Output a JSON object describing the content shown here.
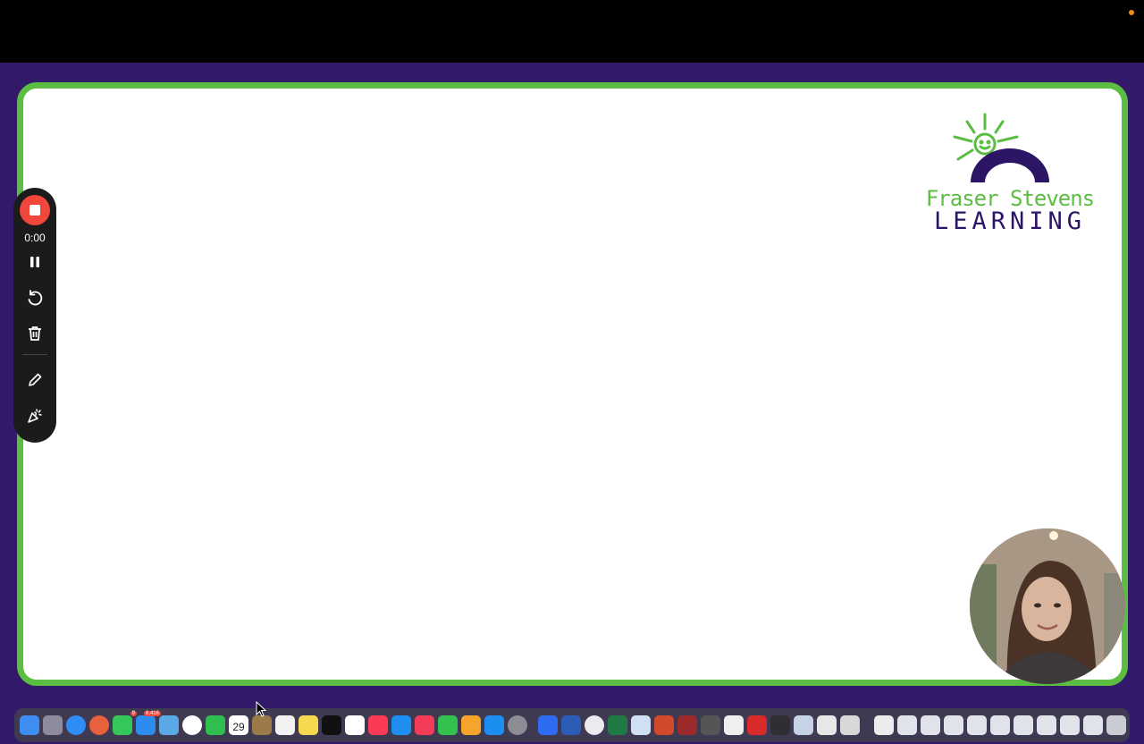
{
  "recorder": {
    "timer": "0:00"
  },
  "logo": {
    "line1": "Fraser Stevens",
    "line2": "LEARNING"
  },
  "dock": {
    "mail_badge": "6,416",
    "messages_badge": "9",
    "calendar_day": "29",
    "colors": {
      "accent_green": "#5cbd43",
      "background_purple": "#33196a",
      "record_red": "#f0463b"
    }
  }
}
